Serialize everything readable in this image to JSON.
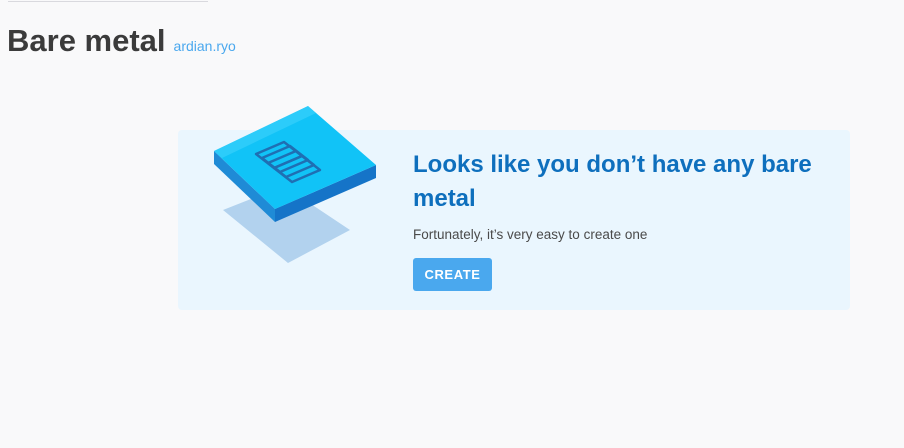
{
  "header": {
    "title": "Bare metal",
    "account": "ardian.ryo"
  },
  "empty_state": {
    "illustration_icon": "bare-metal-server-icon",
    "title": "Looks like you don’t have any bare metal",
    "subtitle": "Fortunately, it’s very easy to create one",
    "create_label": "CREATE"
  },
  "colors": {
    "page_background": "#f9f9fa",
    "card_background": "#eaf6fe",
    "title_color": "#0e6fbd",
    "accent": "#4aa8ee",
    "heading_text": "#3b3b3b"
  }
}
